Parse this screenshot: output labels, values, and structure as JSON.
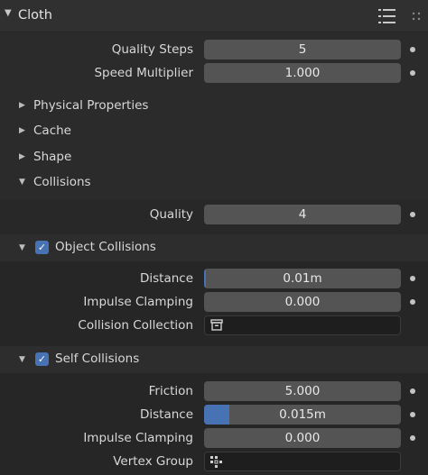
{
  "panel": {
    "title": "Cloth"
  },
  "top_fields": [
    {
      "label": "Quality Steps",
      "value": "5"
    },
    {
      "label": "Speed Multiplier",
      "value": "1.000"
    }
  ],
  "subpanels": [
    {
      "label": "Physical Properties",
      "expanded": false
    },
    {
      "label": "Cache",
      "expanded": false
    },
    {
      "label": "Shape",
      "expanded": false
    },
    {
      "label": "Collisions",
      "expanded": true
    }
  ],
  "collisions": {
    "quality": {
      "label": "Quality",
      "value": "4"
    },
    "object_collisions": {
      "label": "Object Collisions",
      "checked": true,
      "distance": {
        "label": "Distance",
        "value": "0.01m",
        "fill_fraction": 0.005
      },
      "impulse_clamping": {
        "label": "Impulse Clamping",
        "value": "0.000"
      },
      "collision_collection": {
        "label": "Collision Collection",
        "value": "",
        "icon": "collection-icon"
      }
    },
    "self_collisions": {
      "label": "Self Collisions",
      "checked": true,
      "friction": {
        "label": "Friction",
        "value": "5.000"
      },
      "distance": {
        "label": "Distance",
        "value": "0.015m",
        "fill_fraction": 0.13
      },
      "impulse_clamping": {
        "label": "Impulse Clamping",
        "value": "0.000"
      },
      "vertex_group": {
        "label": "Vertex Group",
        "value": "",
        "icon": "vertex-group-icon"
      }
    }
  },
  "colors": {
    "accent": "#4772b3",
    "field": "#545454",
    "panel": "#2b2b2b"
  }
}
